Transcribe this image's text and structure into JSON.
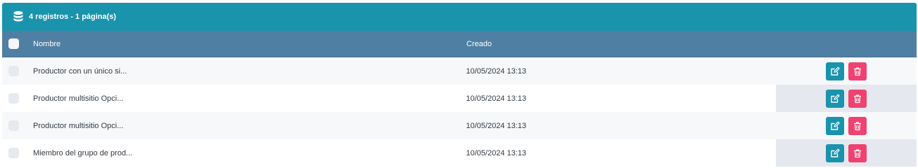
{
  "header": {
    "summary": "4 registros - 1 página(s)",
    "icon": "database-icon"
  },
  "columns": {
    "name": "Nombre",
    "created": "Creado"
  },
  "rows": [
    {
      "name": "Productor con un único si...",
      "created": "10/05/2024 13:13"
    },
    {
      "name": "Productor multisitio Opci...",
      "created": "10/05/2024 13:13"
    },
    {
      "name": "Productor multisitio Opci...",
      "created": "10/05/2024 13:13"
    },
    {
      "name": "Miembro del grupo de prod...",
      "created": "10/05/2024 13:13"
    }
  ],
  "colors": {
    "header_bg": "#1a93ad",
    "table_head_bg": "#4f7fa3",
    "edit_button": "#1a93ad",
    "delete_button": "#ef4270"
  },
  "icons": {
    "edit": "edit-icon",
    "delete": "trash-icon"
  }
}
